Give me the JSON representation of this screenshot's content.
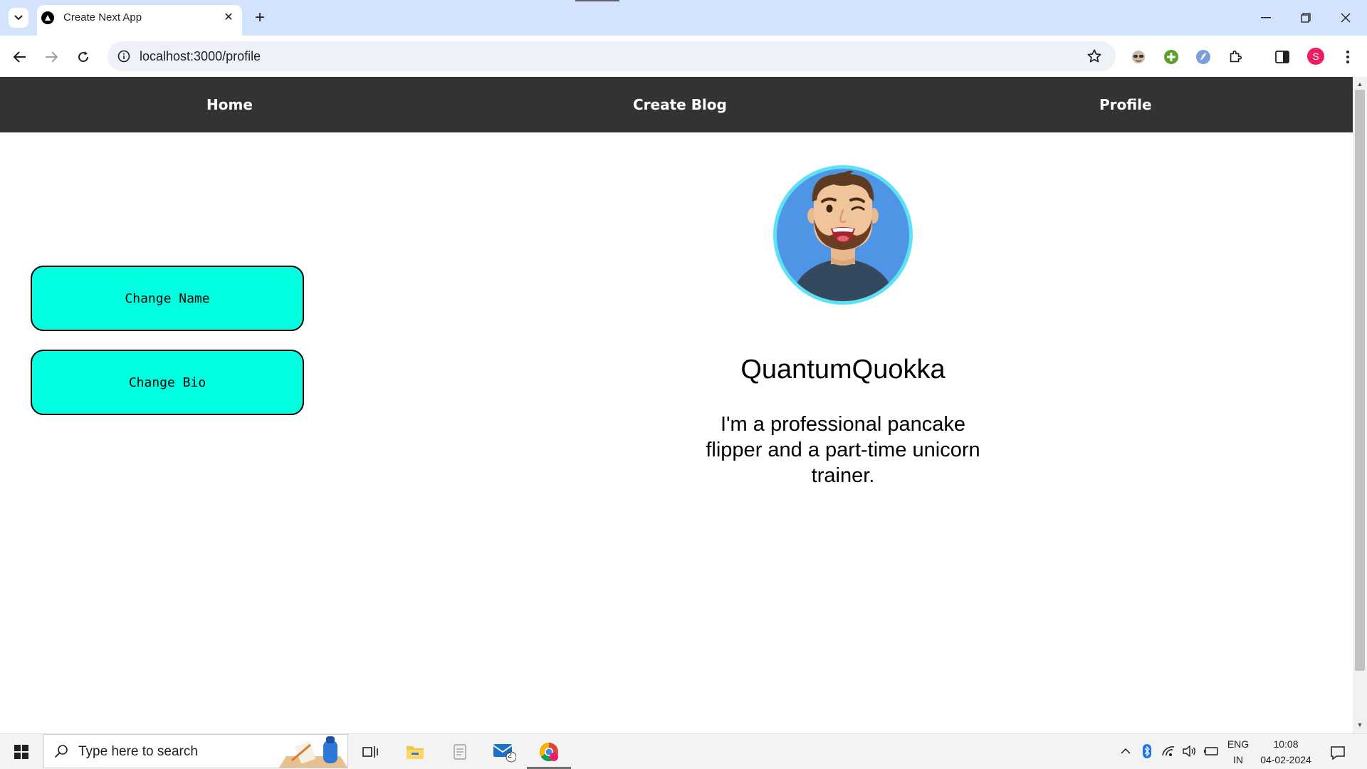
{
  "browser": {
    "tab_title": "Create Next App",
    "url": "localhost:3000/profile",
    "profile_initial": "S"
  },
  "nav": {
    "home": "Home",
    "create_blog": "Create Blog",
    "profile": "Profile"
  },
  "actions": {
    "change_name": "Change Name",
    "change_bio": "Change Bio"
  },
  "profile": {
    "username": "QuantumQuokka",
    "bio": "I'm a professional pancake flipper and a part-time unicorn trainer."
  },
  "taskbar": {
    "search_placeholder": "Type here to search",
    "mail_badge": "2",
    "language": "ENG",
    "region": "IN",
    "time": "10:08",
    "date": "04-02-2024"
  },
  "colors": {
    "navbar": "#333333",
    "button_fill": "#00ffe1",
    "avatar_ring": "#5ce1f5",
    "avatar_bg": "#4f95e6"
  }
}
